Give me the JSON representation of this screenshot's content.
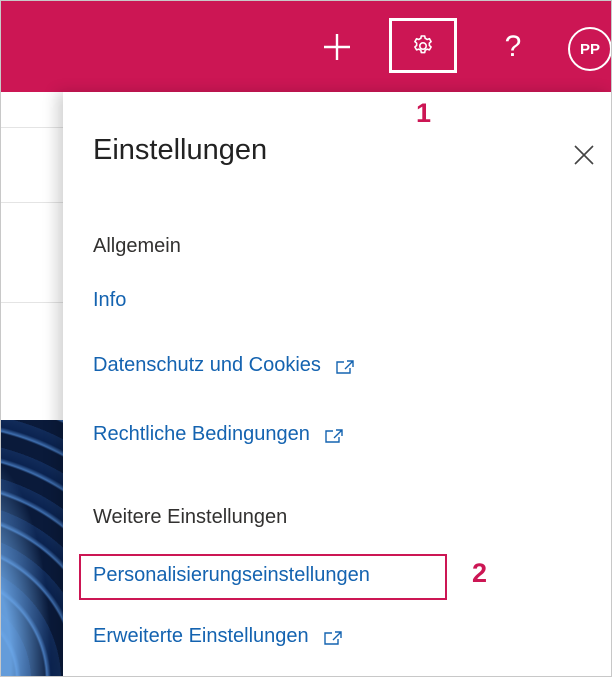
{
  "topbar": {
    "bg_color": "#cc1654",
    "icons": [
      "plus-icon",
      "gear-icon",
      "question-icon"
    ],
    "help_label": "?",
    "avatar_initials": "PP"
  },
  "annotations": {
    "step1": "1",
    "step2": "2",
    "highlight_color": "#cc1654"
  },
  "panel": {
    "title": "Einstellungen",
    "close_icon": "close-icon",
    "sections": [
      {
        "heading": "Allgemein",
        "links": [
          {
            "label": "Info",
            "external": false
          },
          {
            "label": "Datenschutz und Cookies",
            "external": true
          },
          {
            "label": "Rechtliche Bedingungen",
            "external": true
          }
        ]
      },
      {
        "heading": "Weitere Einstellungen",
        "links": [
          {
            "label": "Personalisierungseinstellungen",
            "external": false
          },
          {
            "label": "Erweiterte Einstellungen",
            "external": true
          }
        ]
      }
    ],
    "link_color": "#1463b0"
  }
}
